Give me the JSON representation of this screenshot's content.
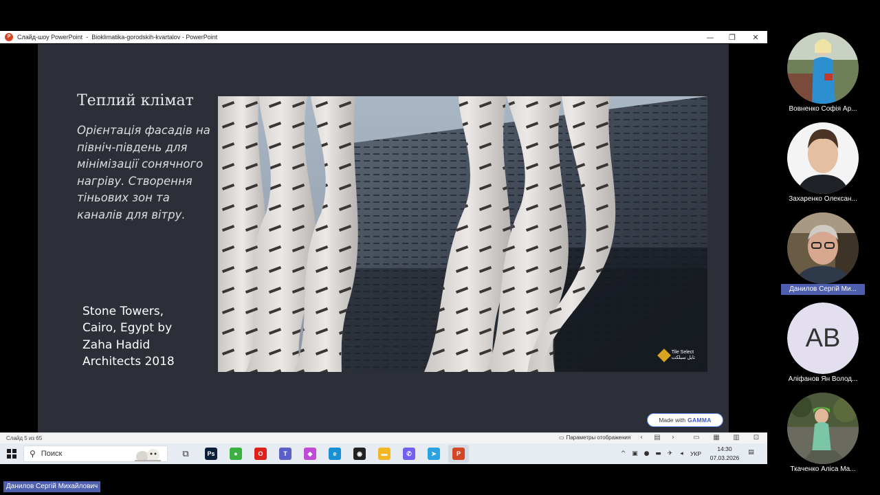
{
  "window": {
    "title_app": "Слайд-шоу PowerPoint",
    "title_file": "Bioklimatika-gorodskih-kvartalov - PowerPoint",
    "separator": "-",
    "minimize": "—",
    "restore": "❐",
    "close": "✕"
  },
  "slide": {
    "title": "Теплий клімат",
    "body": "Орієнтація фасадів на північ-південь для мінімізації сонячного нагріву. Створення тіньових зон та каналів для вітру.",
    "caption": "Stone Towers, Cairo, Egypt by Zaha Hadid Architects 2018",
    "photo_logo_line1": "Tile Select",
    "photo_logo_line2": "تايل سيلكت",
    "badge_prefix": "Made with",
    "badge_brand": "GAMMA"
  },
  "status": {
    "slide_counter": "Слайд 5 из 65",
    "display_settings": "Параметры отображения"
  },
  "taskbar": {
    "search_placeholder": "Поиск",
    "apps": [
      {
        "name": "task-view",
        "label": "⧉"
      },
      {
        "name": "photoshop",
        "label": "Ps",
        "color": "#0b1f3a"
      },
      {
        "name": "app-green",
        "label": "●",
        "color": "#3cb043"
      },
      {
        "name": "opera",
        "label": "O",
        "color": "#e0201b"
      },
      {
        "name": "teams",
        "label": "T",
        "color": "#5b5fc7"
      },
      {
        "name": "copilot",
        "label": "◆",
        "color": "#c04bd6"
      },
      {
        "name": "edge",
        "label": "e",
        "color": "#1a8fd6"
      },
      {
        "name": "eye-app",
        "label": "◉",
        "color": "#222"
      },
      {
        "name": "file-explorer",
        "label": "▬",
        "color": "#f2b824"
      },
      {
        "name": "viber",
        "label": "✆",
        "color": "#7360f2"
      },
      {
        "name": "telegram",
        "label": "➤",
        "color": "#2aa3e0"
      },
      {
        "name": "powerpoint",
        "label": "P",
        "color": "#d24726"
      }
    ],
    "language": "УКР",
    "time": "14:30",
    "date": "07.03.2026"
  },
  "participants": [
    {
      "name": "Вовненко Софія Ар...",
      "active": false
    },
    {
      "name": "Захаренко Олексан...",
      "active": false
    },
    {
      "name": "Данилов Сергій Ми...",
      "active": true
    },
    {
      "name": "Аліфанов Ян Волод...",
      "initials": "АВ",
      "active": false
    },
    {
      "name": "Ткаченко Аліса Ма...",
      "active": false
    }
  ],
  "self_name": "Данилов Сергій Михайлович"
}
